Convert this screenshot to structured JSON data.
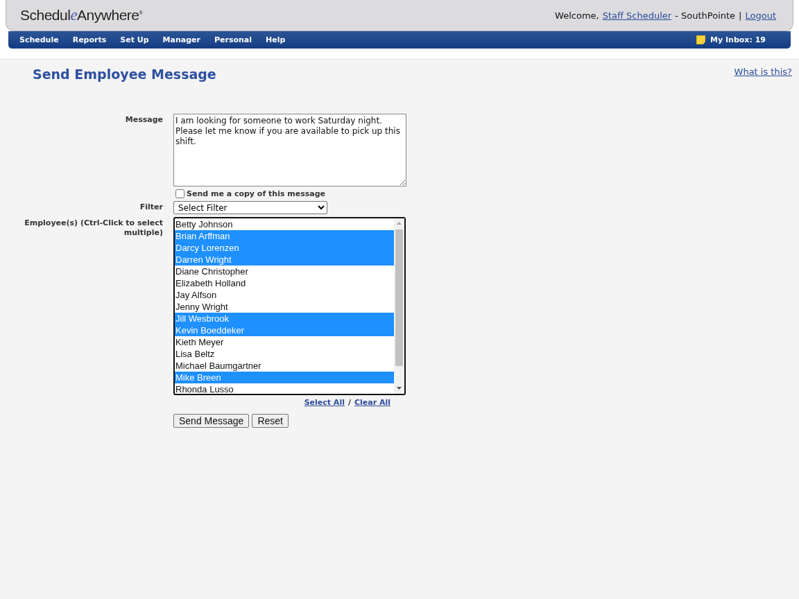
{
  "header": {
    "logo": [
      "Schedul",
      "e",
      "Anywhere",
      "®"
    ],
    "welcome": "Welcome,",
    "user_link": "Staff Scheduler",
    "site": "- SouthPointe",
    "separator": "|",
    "logout_link": "Logout"
  },
  "nav": {
    "items": [
      "Schedule",
      "Reports",
      "Set Up",
      "Manager",
      "Personal",
      "Help"
    ],
    "inbox": "My Inbox: 19"
  },
  "page": {
    "title": "Send Employee Message",
    "help_link": "What is this?"
  },
  "form": {
    "message_label": "Message",
    "message": "I am looking for someone to work Saturday night. Please let me know if you are available to pick up this shift.",
    "copy_checkbox": {
      "label": "Send me a copy of this message",
      "checked": false
    },
    "filter_label": "Filter",
    "filter_value": "Select Filter",
    "employees_label": "Employee(s) (Ctrl-Click to select multiple)",
    "employees": [
      {
        "name": "Betty Johnson",
        "selected": false
      },
      {
        "name": "Brian Arffman",
        "selected": true
      },
      {
        "name": "Darcy Lorenzen",
        "selected": true
      },
      {
        "name": "Darren Wright",
        "selected": true
      },
      {
        "name": "Diane Christopher",
        "selected": false
      },
      {
        "name": "Elizabeth Holland",
        "selected": false
      },
      {
        "name": "Jay Alfson",
        "selected": false
      },
      {
        "name": "Jenny Wright",
        "selected": false
      },
      {
        "name": "Jill Wesbrook",
        "selected": true
      },
      {
        "name": "Kevin Boeddeker",
        "selected": true
      },
      {
        "name": "Kieth Meyer",
        "selected": false
      },
      {
        "name": "Lisa Beltz",
        "selected": false
      },
      {
        "name": "Michael Baumgartner",
        "selected": false
      },
      {
        "name": "Mike Breen",
        "selected": true
      },
      {
        "name": "Rhonda Lusso",
        "selected": false
      }
    ],
    "select_all": "Select All",
    "slash": "/",
    "clear_all": "Clear All",
    "buttons": [
      "Send Message",
      "Reset"
    ]
  }
}
